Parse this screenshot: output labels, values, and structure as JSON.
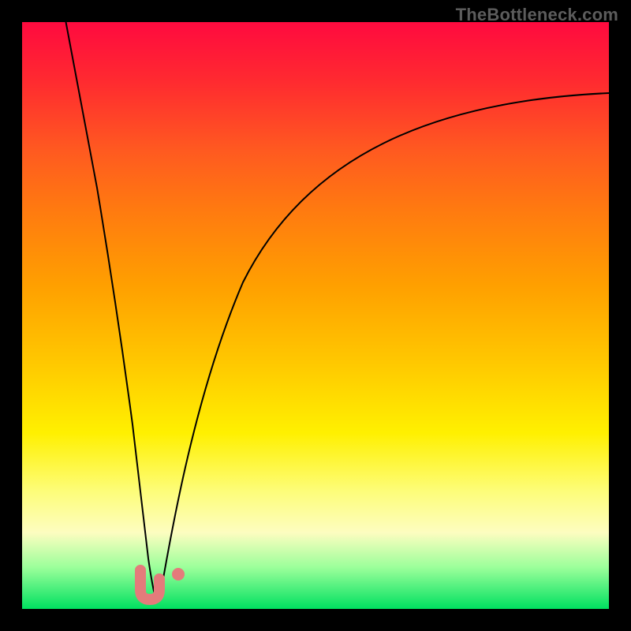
{
  "watermark": "TheBottleneck.com",
  "colors": {
    "frame": "#000000",
    "gradient_top": "#ff0a3f",
    "gradient_bottom": "#00e060",
    "curve": "#000000",
    "marker": "#e47b7b"
  },
  "chart_data": {
    "type": "line",
    "title": "",
    "xlabel": "",
    "ylabel": "",
    "xlim": [
      0,
      100
    ],
    "ylim": [
      0,
      100
    ],
    "annotations": [
      "V-shaped bottleneck curve with minimum near x≈22; U-shaped salmon marker at trough; single salmon dot slightly right of trough"
    ],
    "series": [
      {
        "name": "left-branch",
        "x": [
          0,
          3,
          6,
          9,
          12,
          15,
          17.5,
          19.5,
          21,
          22
        ],
        "values": [
          115,
          95,
          76,
          58,
          42,
          27,
          16,
          8,
          3,
          1
        ]
      },
      {
        "name": "right-branch",
        "x": [
          22,
          24,
          27,
          31,
          36,
          43,
          52,
          63,
          76,
          90,
          100
        ],
        "values": [
          1,
          6,
          17,
          31,
          45,
          58,
          68,
          76,
          82,
          86,
          88
        ]
      }
    ],
    "markers": [
      {
        "name": "u-marker",
        "shape": "u-pill",
        "x_center": 21.5,
        "y_center": 3,
        "width": 4,
        "height": 5
      },
      {
        "name": "dot",
        "shape": "circle",
        "x": 26,
        "y": 4.5,
        "r": 1.2
      }
    ]
  }
}
